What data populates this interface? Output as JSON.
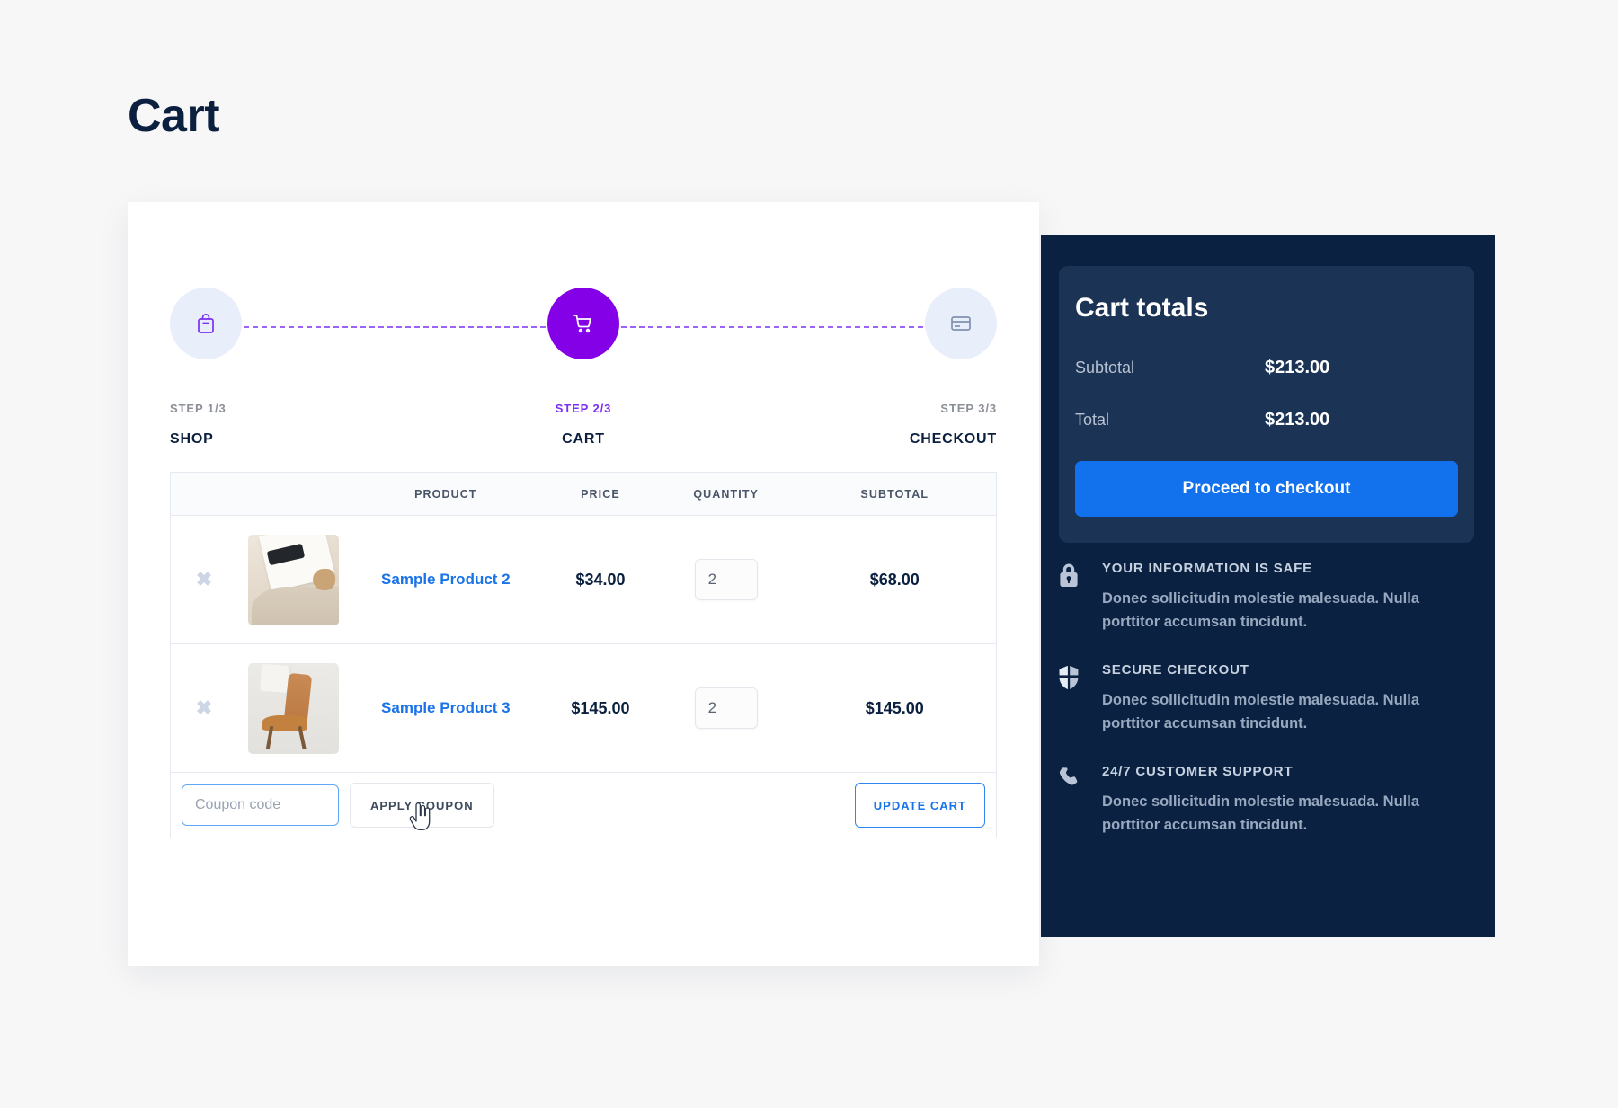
{
  "page": {
    "title": "Cart"
  },
  "stepper": {
    "steps": [
      {
        "num": "STEP 1/3",
        "name": "SHOP",
        "icon": "shopping-bag-icon",
        "state": "done"
      },
      {
        "num": "STEP 2/3",
        "name": "CART",
        "icon": "shopping-cart-icon",
        "state": "active"
      },
      {
        "num": "STEP 3/3",
        "name": "CHECKOUT",
        "icon": "credit-card-icon",
        "state": "upcoming"
      }
    ],
    "active_color": "#8400e7",
    "line_color": "#7b2ff2"
  },
  "table": {
    "headers": {
      "product": "PRODUCT",
      "price": "PRICE",
      "quantity": "QUANTITY",
      "subtotal": "SUBTOTAL"
    },
    "remove_glyph": "✖",
    "rows": [
      {
        "name": "Sample Product 2",
        "price": "$34.00",
        "quantity": "2",
        "subtotal": "$68.00",
        "thumb": "product-thumbnail-glasses"
      },
      {
        "name": "Sample Product 3",
        "price": "$145.00",
        "quantity": "2",
        "subtotal": "$145.00",
        "thumb": "product-thumbnail-chair"
      }
    ]
  },
  "coupon": {
    "placeholder": "Coupon code",
    "value": "",
    "apply_label": "APPLY COUPON",
    "update_label": "UPDATE CART"
  },
  "totals": {
    "title": "Cart totals",
    "rows": [
      {
        "label": "Subtotal",
        "value": "$213.00"
      },
      {
        "label": "Total",
        "value": "$213.00"
      }
    ],
    "checkout_label": "Proceed to checkout",
    "checkout_color": "#1271ec"
  },
  "features": [
    {
      "icon": "lock-icon",
      "title": "YOUR INFORMATION IS SAFE",
      "text": "Donec sollicitudin molestie malesuada. Nulla porttitor accumsan tincidunt."
    },
    {
      "icon": "shield-icon",
      "title": "SECURE CHECKOUT",
      "text": "Donec sollicitudin molestie malesuada. Nulla porttitor accumsan tincidunt."
    },
    {
      "icon": "phone-icon",
      "title": "24/7 CUSTOMER SUPPORT",
      "text": "Donec sollicitudin molestie malesuada. Nulla porttitor accumsan tincidunt."
    }
  ]
}
